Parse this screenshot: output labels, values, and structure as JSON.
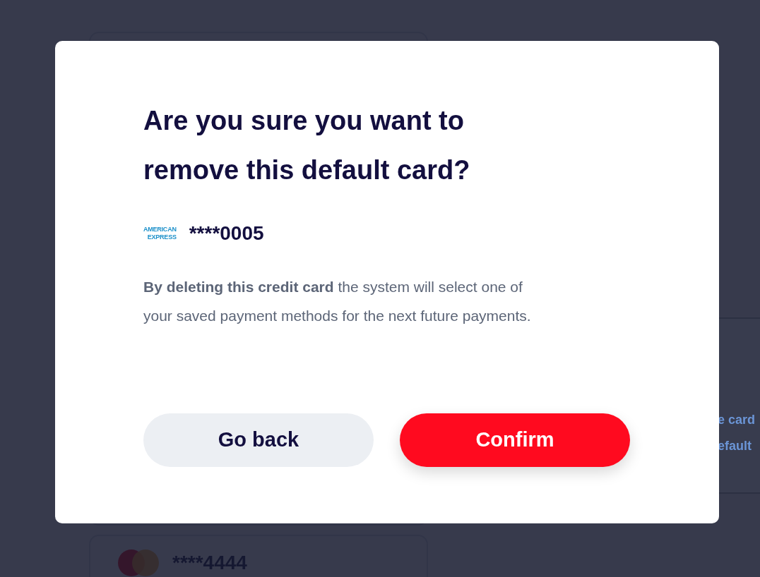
{
  "background": {
    "cards": [
      {
        "number": "****4444"
      }
    ],
    "side_panel": {
      "lines": [
        "e card",
        "efault"
      ]
    }
  },
  "dialog": {
    "title": "Are you sure you want to remove this default card?",
    "card": {
      "brand_lines": [
        "AMERICAN",
        "EXPRESS"
      ],
      "number": "****0005"
    },
    "message": "**By deleting this credit card** the system will select one of your saved payment methods for the next future payments.",
    "buttons": [
      {
        "label": "Go back",
        "kind": "secondary"
      },
      {
        "label": "Confirm",
        "kind": "primary"
      }
    ]
  }
}
